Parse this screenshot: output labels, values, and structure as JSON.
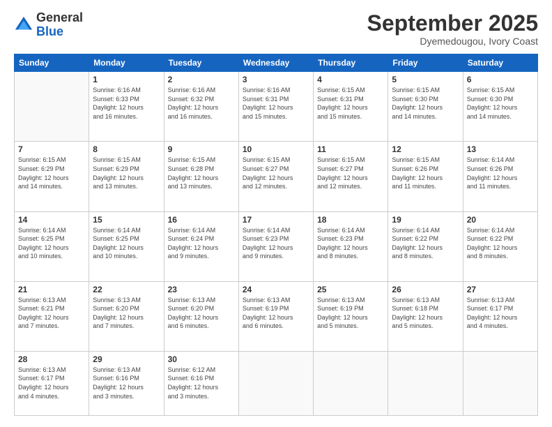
{
  "logo": {
    "general": "General",
    "blue": "Blue"
  },
  "title": "September 2025",
  "location": "Dyemedougou, Ivory Coast",
  "days_of_week": [
    "Sunday",
    "Monday",
    "Tuesday",
    "Wednesday",
    "Thursday",
    "Friday",
    "Saturday"
  ],
  "weeks": [
    [
      {
        "day": "",
        "info": ""
      },
      {
        "day": "1",
        "info": "Sunrise: 6:16 AM\nSunset: 6:33 PM\nDaylight: 12 hours\nand 16 minutes."
      },
      {
        "day": "2",
        "info": "Sunrise: 6:16 AM\nSunset: 6:32 PM\nDaylight: 12 hours\nand 16 minutes."
      },
      {
        "day": "3",
        "info": "Sunrise: 6:16 AM\nSunset: 6:31 PM\nDaylight: 12 hours\nand 15 minutes."
      },
      {
        "day": "4",
        "info": "Sunrise: 6:15 AM\nSunset: 6:31 PM\nDaylight: 12 hours\nand 15 minutes."
      },
      {
        "day": "5",
        "info": "Sunrise: 6:15 AM\nSunset: 6:30 PM\nDaylight: 12 hours\nand 14 minutes."
      },
      {
        "day": "6",
        "info": "Sunrise: 6:15 AM\nSunset: 6:30 PM\nDaylight: 12 hours\nand 14 minutes."
      }
    ],
    [
      {
        "day": "7",
        "info": "Sunrise: 6:15 AM\nSunset: 6:29 PM\nDaylight: 12 hours\nand 14 minutes."
      },
      {
        "day": "8",
        "info": "Sunrise: 6:15 AM\nSunset: 6:29 PM\nDaylight: 12 hours\nand 13 minutes."
      },
      {
        "day": "9",
        "info": "Sunrise: 6:15 AM\nSunset: 6:28 PM\nDaylight: 12 hours\nand 13 minutes."
      },
      {
        "day": "10",
        "info": "Sunrise: 6:15 AM\nSunset: 6:27 PM\nDaylight: 12 hours\nand 12 minutes."
      },
      {
        "day": "11",
        "info": "Sunrise: 6:15 AM\nSunset: 6:27 PM\nDaylight: 12 hours\nand 12 minutes."
      },
      {
        "day": "12",
        "info": "Sunrise: 6:15 AM\nSunset: 6:26 PM\nDaylight: 12 hours\nand 11 minutes."
      },
      {
        "day": "13",
        "info": "Sunrise: 6:14 AM\nSunset: 6:26 PM\nDaylight: 12 hours\nand 11 minutes."
      }
    ],
    [
      {
        "day": "14",
        "info": "Sunrise: 6:14 AM\nSunset: 6:25 PM\nDaylight: 12 hours\nand 10 minutes."
      },
      {
        "day": "15",
        "info": "Sunrise: 6:14 AM\nSunset: 6:25 PM\nDaylight: 12 hours\nand 10 minutes."
      },
      {
        "day": "16",
        "info": "Sunrise: 6:14 AM\nSunset: 6:24 PM\nDaylight: 12 hours\nand 9 minutes."
      },
      {
        "day": "17",
        "info": "Sunrise: 6:14 AM\nSunset: 6:23 PM\nDaylight: 12 hours\nand 9 minutes."
      },
      {
        "day": "18",
        "info": "Sunrise: 6:14 AM\nSunset: 6:23 PM\nDaylight: 12 hours\nand 8 minutes."
      },
      {
        "day": "19",
        "info": "Sunrise: 6:14 AM\nSunset: 6:22 PM\nDaylight: 12 hours\nand 8 minutes."
      },
      {
        "day": "20",
        "info": "Sunrise: 6:14 AM\nSunset: 6:22 PM\nDaylight: 12 hours\nand 8 minutes."
      }
    ],
    [
      {
        "day": "21",
        "info": "Sunrise: 6:13 AM\nSunset: 6:21 PM\nDaylight: 12 hours\nand 7 minutes."
      },
      {
        "day": "22",
        "info": "Sunrise: 6:13 AM\nSunset: 6:20 PM\nDaylight: 12 hours\nand 7 minutes."
      },
      {
        "day": "23",
        "info": "Sunrise: 6:13 AM\nSunset: 6:20 PM\nDaylight: 12 hours\nand 6 minutes."
      },
      {
        "day": "24",
        "info": "Sunrise: 6:13 AM\nSunset: 6:19 PM\nDaylight: 12 hours\nand 6 minutes."
      },
      {
        "day": "25",
        "info": "Sunrise: 6:13 AM\nSunset: 6:19 PM\nDaylight: 12 hours\nand 5 minutes."
      },
      {
        "day": "26",
        "info": "Sunrise: 6:13 AM\nSunset: 6:18 PM\nDaylight: 12 hours\nand 5 minutes."
      },
      {
        "day": "27",
        "info": "Sunrise: 6:13 AM\nSunset: 6:17 PM\nDaylight: 12 hours\nand 4 minutes."
      }
    ],
    [
      {
        "day": "28",
        "info": "Sunrise: 6:13 AM\nSunset: 6:17 PM\nDaylight: 12 hours\nand 4 minutes."
      },
      {
        "day": "29",
        "info": "Sunrise: 6:13 AM\nSunset: 6:16 PM\nDaylight: 12 hours\nand 3 minutes."
      },
      {
        "day": "30",
        "info": "Sunrise: 6:12 AM\nSunset: 6:16 PM\nDaylight: 12 hours\nand 3 minutes."
      },
      {
        "day": "",
        "info": ""
      },
      {
        "day": "",
        "info": ""
      },
      {
        "day": "",
        "info": ""
      },
      {
        "day": "",
        "info": ""
      }
    ]
  ]
}
